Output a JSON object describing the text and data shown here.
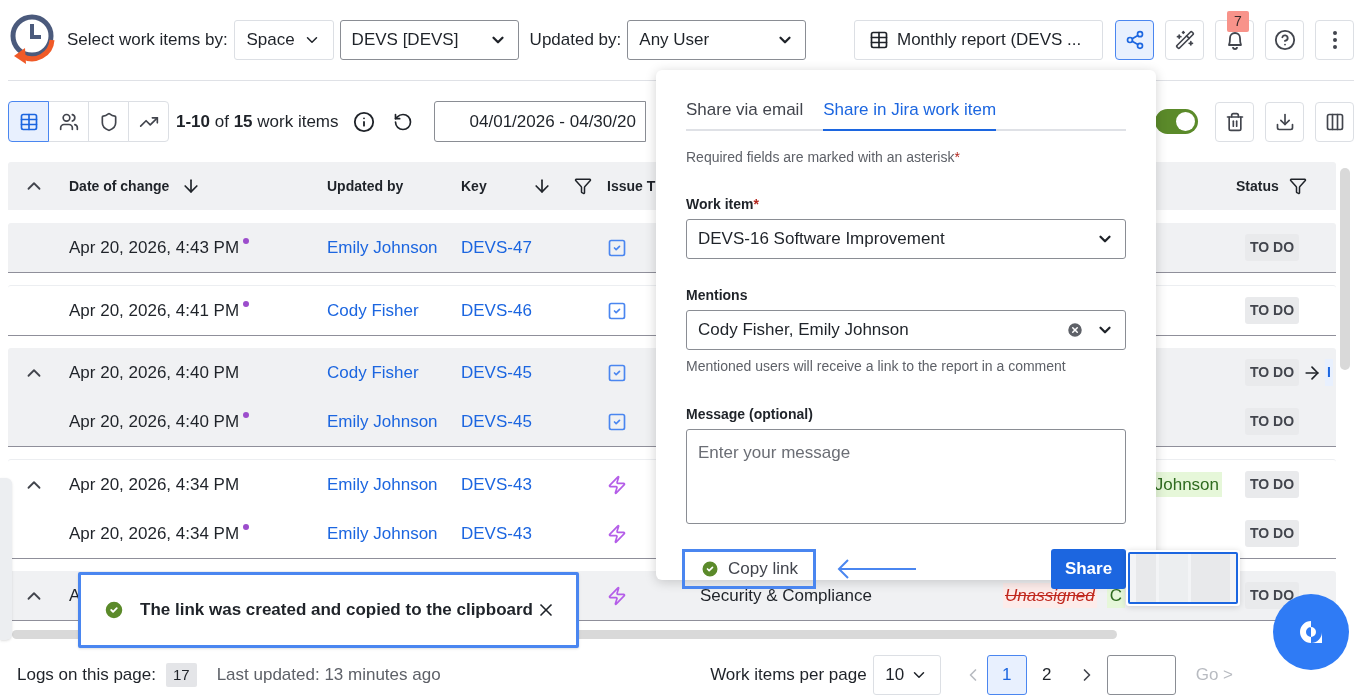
{
  "header": {
    "select_label": "Select work items by:",
    "scope": "Space",
    "project": "DEVS [DEVS]",
    "updated_label": "Updated by:",
    "user": "Any User",
    "report": "Monthly report (DEVS ...",
    "share_selected": true,
    "notification_count": "7"
  },
  "toolbar": {
    "views": [
      {
        "kind": "table",
        "selected": true
      },
      {
        "kind": "users",
        "selected": false
      },
      {
        "kind": "shield",
        "selected": false
      },
      {
        "kind": "chart",
        "selected": false
      }
    ],
    "summary": "**1-10** of **15** work items",
    "date_range": "04/01/2026 - 04/30/20",
    "toggle_on": true
  },
  "table": {
    "columns": [
      {
        "kind": "date",
        "label": "Date of change",
        "sorted": true,
        "filter": false
      },
      {
        "kind": "updated_by",
        "label": "Updated by",
        "sorted": false,
        "filter": false
      },
      {
        "kind": "key",
        "label": "Key",
        "sorted": true,
        "filter": true
      },
      {
        "kind": "type",
        "label": "Issue T",
        "sorted": false,
        "filter": false
      },
      {
        "kind": "status",
        "label": "Status",
        "sorted": false,
        "filter": true
      }
    ],
    "groups": [
      {
        "shaded": true,
        "rows": [
          {
            "expandable": false,
            "date": "Apr 20, 2026, 4:43 PM",
            "new": true,
            "updated_by": "Emily Johnson",
            "key": "DEVS-47",
            "kind": "task",
            "status": "TO DO"
          }
        ]
      },
      {
        "shaded": false,
        "rows": [
          {
            "expandable": false,
            "date": "Apr 20, 2026, 4:41 PM",
            "new": true,
            "updated_by": "Cody Fisher",
            "key": "DEVS-46",
            "kind": "task",
            "status": "TO DO"
          }
        ]
      },
      {
        "shaded": true,
        "rows": [
          {
            "expandable": true,
            "date": "Apr 20, 2026, 4:40 PM",
            "new": false,
            "updated_by": "Cody Fisher",
            "key": "DEVS-45",
            "kind": "task",
            "status": "TO DO",
            "status_to": "I"
          },
          {
            "expandable": false,
            "date": "Apr 20, 2026, 4:40 PM",
            "new": true,
            "updated_by": "Emily Johnson",
            "key": "DEVS-45",
            "kind": "task",
            "status": "TO DO"
          }
        ]
      },
      {
        "shaded": false,
        "rows": [
          {
            "expandable": true,
            "date": "Apr 20, 2026, 4:34 PM",
            "new": false,
            "updated_by": "Emily Johnson",
            "key": "DEVS-43",
            "kind": "lightning",
            "assignee_to": "Johnson",
            "status": "TO DO"
          },
          {
            "expandable": false,
            "date": "Apr 20, 2026, 4:34 PM",
            "new": true,
            "updated_by": "Emily Johnson",
            "key": "DEVS-43",
            "kind": "lightning",
            "status": "TO DO"
          }
        ]
      },
      {
        "shaded": true,
        "rows": [
          {
            "expandable": true,
            "date": "A",
            "new": false,
            "kind": "lightning",
            "summary": "Security & Compliance",
            "assignee_from": "Unassigned",
            "assignee_to": "C",
            "status": "TO DO"
          }
        ]
      }
    ]
  },
  "share_popover": {
    "tabs": [
      {
        "label": "Share via email",
        "selected": false
      },
      {
        "label": "Share in Jira work item",
        "selected": true
      }
    ],
    "required_note": "Required fields are marked with an asterisk",
    "asterisk": "*",
    "work_item": {
      "label": "Work item",
      "required_mark": "*",
      "value": "DEVS-16 Software Improvement"
    },
    "mentions": {
      "label": "Mentions",
      "value": "Cody Fisher, Emily Johnson",
      "help": "Mentioned users will receive a link to the report in a comment"
    },
    "message": {
      "label": "Message (optional)",
      "placeholder": "Enter your message"
    },
    "copy_link": {
      "label": "Copy link",
      "copied": true
    },
    "share_label": "Share"
  },
  "toast": {
    "message": "The link was created and copied to the clipboard"
  },
  "footer": {
    "logs_label": "Logs on this page:",
    "logs_count": "17",
    "last_updated": "Last updated: 13 minutes ago",
    "per_page_label": "Work items per page",
    "per_page": "10",
    "pages": [
      {
        "label": "1",
        "selected": true
      },
      {
        "label": "2",
        "selected": false
      }
    ],
    "go": "Go >"
  }
}
